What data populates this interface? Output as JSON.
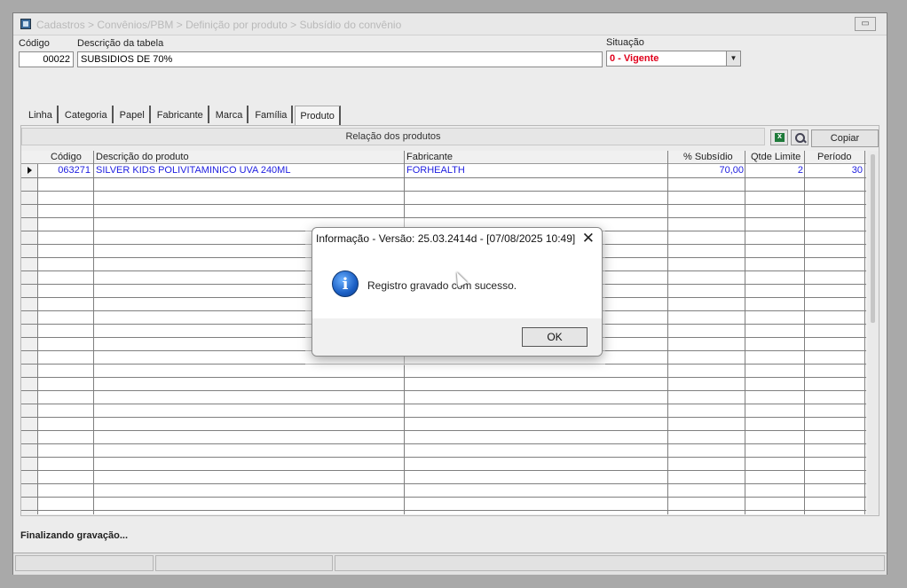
{
  "window": {
    "title": "Cadastros > Convênios/PBM > Definição por produto > Subsídio do convênio"
  },
  "form": {
    "codigo_label": "Código",
    "codigo_value": "00022",
    "descricao_label": "Descrição da tabela",
    "descricao_value": "SUBSIDIOS DE 70%",
    "situacao_label": "Situação",
    "situacao_value": "0 - Vigente"
  },
  "tabs": [
    {
      "label": "Linha"
    },
    {
      "label": "Categoria"
    },
    {
      "label": "Papel"
    },
    {
      "label": "Fabricante"
    },
    {
      "label": "Marca"
    },
    {
      "label": "Família"
    },
    {
      "label": "Produto"
    }
  ],
  "panel": {
    "header": "Relação dos produtos",
    "copy_label": "Copiar"
  },
  "grid": {
    "columns": [
      "Código",
      "Descrição do produto",
      "Fabricante",
      "% Subsídio",
      "Qtde Limite",
      "Período"
    ],
    "rows": [
      {
        "codigo": "063271",
        "descricao": "SILVER KIDS POLIVITAMINICO UVA 240ML",
        "fabricante": "FORHEALTH",
        "subsidio": "70,00",
        "qtde": "2",
        "periodo": "30"
      }
    ]
  },
  "status": {
    "message": "Finalizando gravação..."
  },
  "dialog": {
    "title": "Informação - Versão: 25.03.2414d - [07/08/2025 10:49]",
    "message": "Registro gravado com sucesso.",
    "ok_label": "OK"
  },
  "colors": {
    "situacao_text": "#e0001c",
    "grid_text": "#2020e0"
  },
  "icons": {
    "excel": "excel-icon",
    "search": "search-icon",
    "info": "info-icon",
    "close": "close-icon"
  }
}
